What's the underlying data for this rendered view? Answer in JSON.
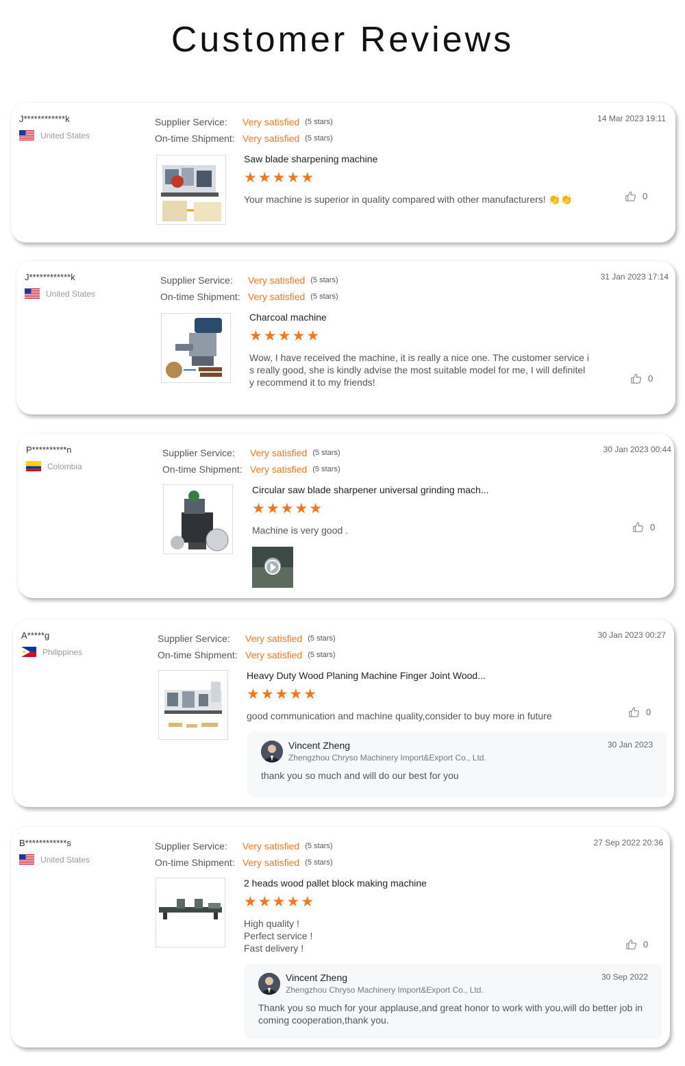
{
  "page": {
    "title": "Customer Reviews"
  },
  "labels": {
    "supplier_service": "Supplier Service:",
    "ontime_shipment": "On-time Shipment:",
    "reply_name": "Vincent Zheng",
    "reply_company": "Zhengzhou Chryso Machinery Import&Export Co., Ltd."
  },
  "colors": {
    "accent": "#f4771e",
    "muted_text": "#999999",
    "body_text": "#555555"
  },
  "reviews": [
    {
      "user": "J************k",
      "country": "United States",
      "flag": "us-flag-icon",
      "date": "14 Mar 2023 19:11",
      "supplier_service": "Very satisfied",
      "supplier_service_stars": "(5 stars)",
      "shipment": "Very satisfied",
      "shipment_stars": "(5 stars)",
      "product": "Saw blade sharpening machine",
      "rating": 5,
      "comment": "Your machine is superior in quality compared with other manufacturers! 👏👏",
      "likes": "0"
    },
    {
      "user": "J************k",
      "country": "United States",
      "flag": "us-flag-icon",
      "date": "31 Jan 2023 17:14",
      "supplier_service": "Very satisfied",
      "supplier_service_stars": "(5 stars)",
      "shipment": "Very satisfied",
      "shipment_stars": "(5 stars)",
      "product": "Charcoal machine",
      "rating": 5,
      "comment": "Wow, I have received the machine, it is really a nice one. The customer service is really good, she is kindly advise the most suitable model for me, I will definitely recommend it to my friends!",
      "likes": "0"
    },
    {
      "user": "P**********n",
      "country": "Colombia",
      "flag": "colombia-flag-icon",
      "date": "30 Jan 2023 00:44",
      "supplier_service": "Very satisfied",
      "supplier_service_stars": "(5 stars)",
      "shipment": "Very satisfied",
      "shipment_stars": "(5 stars)",
      "product": "Circular saw blade sharpener universal grinding mach...",
      "rating": 5,
      "comment": "Machine is very good .",
      "likes": "0"
    },
    {
      "user": "A*****g",
      "country": "Philippines",
      "flag": "philippines-flag-icon",
      "date": "30 Jan 2023 00:27",
      "supplier_service": "Very satisfied",
      "supplier_service_stars": "(5 stars)",
      "shipment": "Very satisfied",
      "shipment_stars": "(5 stars)",
      "product": "Heavy Duty Wood Planing Machine Finger Joint Wood...",
      "rating": 5,
      "comment": "good communication and machine quality,consider to buy more in future",
      "likes": "0",
      "reply": {
        "date": "30 Jan 2023",
        "text": "thank you so much and will do our best for you"
      }
    },
    {
      "user": "B************s",
      "country": "United States",
      "flag": "us-flag-icon",
      "date": "27 Sep 2022 20:36",
      "supplier_service": "Very satisfied",
      "supplier_service_stars": "(5 stars)",
      "shipment": "Very satisfied",
      "shipment_stars": "(5 stars)",
      "product": "2 heads wood pallet block making machine",
      "rating": 5,
      "comment": "High quality !\nPerfect service !\nFast delivery !",
      "likes": "0",
      "reply": {
        "date": "30 Sep 2022",
        "text": "Thank you so much for your applause,and great honor to work with you,will do better job in coming cooperation,thank you."
      }
    }
  ]
}
